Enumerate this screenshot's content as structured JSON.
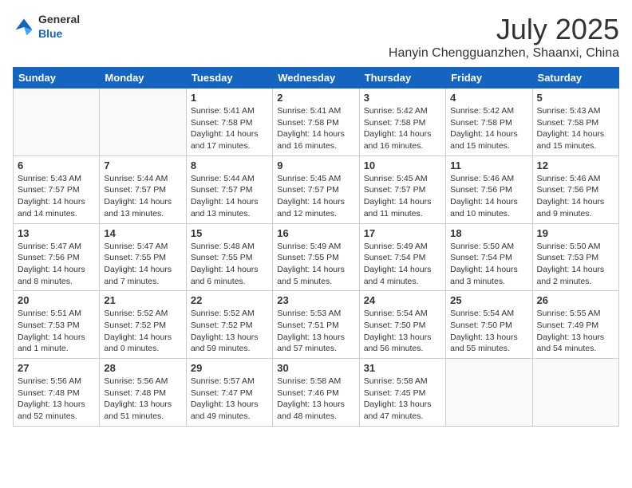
{
  "logo": {
    "general": "General",
    "blue": "Blue"
  },
  "title": "July 2025",
  "location": "Hanyin Chengguanzhen, Shaanxi, China",
  "days_of_week": [
    "Sunday",
    "Monday",
    "Tuesday",
    "Wednesday",
    "Thursday",
    "Friday",
    "Saturday"
  ],
  "weeks": [
    [
      {
        "day": "",
        "info": ""
      },
      {
        "day": "",
        "info": ""
      },
      {
        "day": "1",
        "info": "Sunrise: 5:41 AM\nSunset: 7:58 PM\nDaylight: 14 hours and 17 minutes."
      },
      {
        "day": "2",
        "info": "Sunrise: 5:41 AM\nSunset: 7:58 PM\nDaylight: 14 hours and 16 minutes."
      },
      {
        "day": "3",
        "info": "Sunrise: 5:42 AM\nSunset: 7:58 PM\nDaylight: 14 hours and 16 minutes."
      },
      {
        "day": "4",
        "info": "Sunrise: 5:42 AM\nSunset: 7:58 PM\nDaylight: 14 hours and 15 minutes."
      },
      {
        "day": "5",
        "info": "Sunrise: 5:43 AM\nSunset: 7:58 PM\nDaylight: 14 hours and 15 minutes."
      }
    ],
    [
      {
        "day": "6",
        "info": "Sunrise: 5:43 AM\nSunset: 7:57 PM\nDaylight: 14 hours and 14 minutes."
      },
      {
        "day": "7",
        "info": "Sunrise: 5:44 AM\nSunset: 7:57 PM\nDaylight: 14 hours and 13 minutes."
      },
      {
        "day": "8",
        "info": "Sunrise: 5:44 AM\nSunset: 7:57 PM\nDaylight: 14 hours and 13 minutes."
      },
      {
        "day": "9",
        "info": "Sunrise: 5:45 AM\nSunset: 7:57 PM\nDaylight: 14 hours and 12 minutes."
      },
      {
        "day": "10",
        "info": "Sunrise: 5:45 AM\nSunset: 7:57 PM\nDaylight: 14 hours and 11 minutes."
      },
      {
        "day": "11",
        "info": "Sunrise: 5:46 AM\nSunset: 7:56 PM\nDaylight: 14 hours and 10 minutes."
      },
      {
        "day": "12",
        "info": "Sunrise: 5:46 AM\nSunset: 7:56 PM\nDaylight: 14 hours and 9 minutes."
      }
    ],
    [
      {
        "day": "13",
        "info": "Sunrise: 5:47 AM\nSunset: 7:56 PM\nDaylight: 14 hours and 8 minutes."
      },
      {
        "day": "14",
        "info": "Sunrise: 5:47 AM\nSunset: 7:55 PM\nDaylight: 14 hours and 7 minutes."
      },
      {
        "day": "15",
        "info": "Sunrise: 5:48 AM\nSunset: 7:55 PM\nDaylight: 14 hours and 6 minutes."
      },
      {
        "day": "16",
        "info": "Sunrise: 5:49 AM\nSunset: 7:55 PM\nDaylight: 14 hours and 5 minutes."
      },
      {
        "day": "17",
        "info": "Sunrise: 5:49 AM\nSunset: 7:54 PM\nDaylight: 14 hours and 4 minutes."
      },
      {
        "day": "18",
        "info": "Sunrise: 5:50 AM\nSunset: 7:54 PM\nDaylight: 14 hours and 3 minutes."
      },
      {
        "day": "19",
        "info": "Sunrise: 5:50 AM\nSunset: 7:53 PM\nDaylight: 14 hours and 2 minutes."
      }
    ],
    [
      {
        "day": "20",
        "info": "Sunrise: 5:51 AM\nSunset: 7:53 PM\nDaylight: 14 hours and 1 minute."
      },
      {
        "day": "21",
        "info": "Sunrise: 5:52 AM\nSunset: 7:52 PM\nDaylight: 14 hours and 0 minutes."
      },
      {
        "day": "22",
        "info": "Sunrise: 5:52 AM\nSunset: 7:52 PM\nDaylight: 13 hours and 59 minutes."
      },
      {
        "day": "23",
        "info": "Sunrise: 5:53 AM\nSunset: 7:51 PM\nDaylight: 13 hours and 57 minutes."
      },
      {
        "day": "24",
        "info": "Sunrise: 5:54 AM\nSunset: 7:50 PM\nDaylight: 13 hours and 56 minutes."
      },
      {
        "day": "25",
        "info": "Sunrise: 5:54 AM\nSunset: 7:50 PM\nDaylight: 13 hours and 55 minutes."
      },
      {
        "day": "26",
        "info": "Sunrise: 5:55 AM\nSunset: 7:49 PM\nDaylight: 13 hours and 54 minutes."
      }
    ],
    [
      {
        "day": "27",
        "info": "Sunrise: 5:56 AM\nSunset: 7:48 PM\nDaylight: 13 hours and 52 minutes."
      },
      {
        "day": "28",
        "info": "Sunrise: 5:56 AM\nSunset: 7:48 PM\nDaylight: 13 hours and 51 minutes."
      },
      {
        "day": "29",
        "info": "Sunrise: 5:57 AM\nSunset: 7:47 PM\nDaylight: 13 hours and 49 minutes."
      },
      {
        "day": "30",
        "info": "Sunrise: 5:58 AM\nSunset: 7:46 PM\nDaylight: 13 hours and 48 minutes."
      },
      {
        "day": "31",
        "info": "Sunrise: 5:58 AM\nSunset: 7:45 PM\nDaylight: 13 hours and 47 minutes."
      },
      {
        "day": "",
        "info": ""
      },
      {
        "day": "",
        "info": ""
      }
    ]
  ]
}
